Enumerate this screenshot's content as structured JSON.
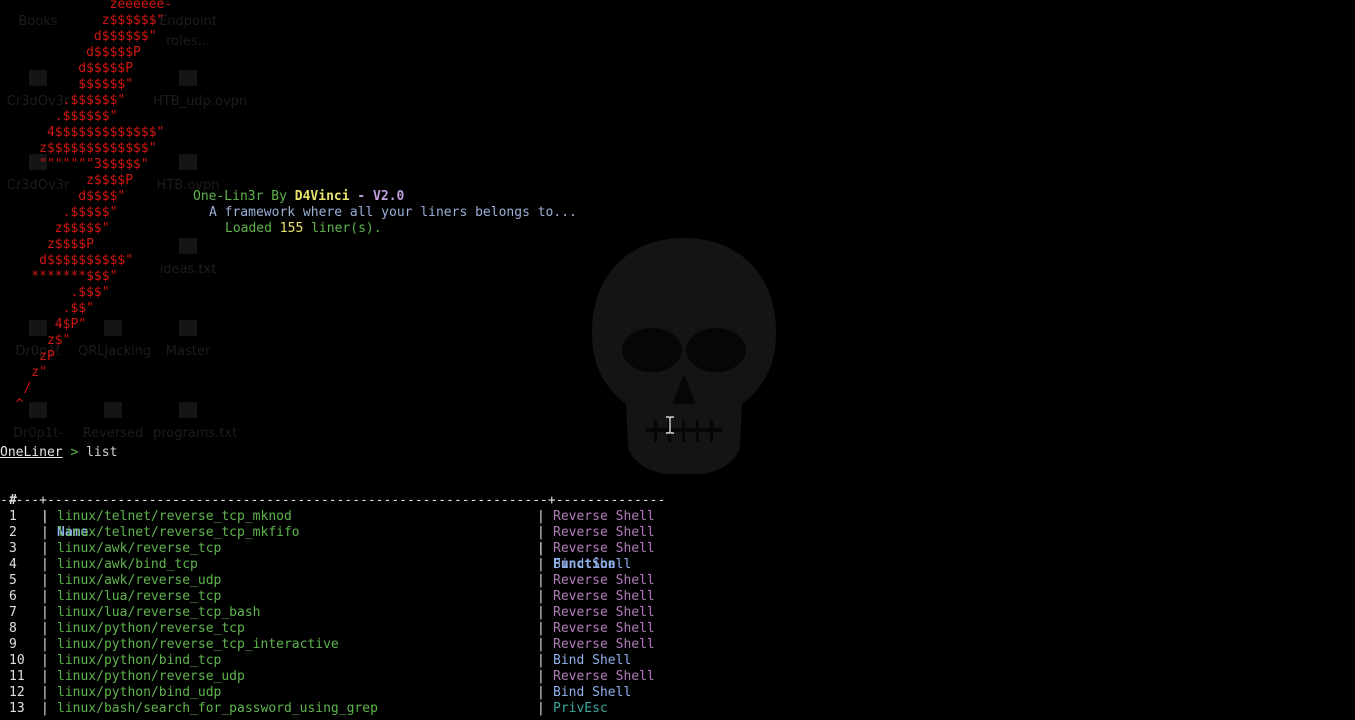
{
  "desktop": {
    "icons": [
      {
        "label": "Books"
      },
      {
        "label": "Endpoint roles..."
      },
      {
        "label": "Cr3dOv3r"
      },
      {
        "label": "HTB_udp.ovpn"
      },
      {
        "label": "Cr3dOv3r"
      },
      {
        "label": "HTB.ovpn"
      },
      {
        "label": "ideas.txt"
      },
      {
        "label": "Dr0p1t"
      },
      {
        "label": "QRLJacking"
      },
      {
        "label": "Master"
      },
      {
        "label": "Dr0p1t-"
      },
      {
        "label": "Reversed"
      },
      {
        "label": "programs.txt"
      }
    ]
  },
  "ascii_art": [
    "              zeeeeee-",
    "             z$$$$$$\"",
    "            d$$$$$$\"",
    "           d$$$$$P",
    "          d$$$$$P",
    "          $$$$$$\"",
    "        .$$$$$$\"",
    "       .$$$$$$\"",
    "      4$$$$$$$$$$$$$\"",
    "     z$$$$$$$$$$$$$\"",
    "     \"\"\"\"\"\"\"3$$$$$\"",
    "           z$$$$P",
    "          d$$$$\"",
    "        .$$$$$\"",
    "       z$$$$$\"",
    "      z$$$$P",
    "     d$$$$$$$$$$\"",
    "    *******$$$\"",
    "         .$$$\"",
    "        .$$\"",
    "       4$P\"",
    "      z$\"",
    "     zP",
    "    z\"",
    "   /",
    "  ^"
  ],
  "banner": {
    "tool": "One-Lin3r",
    "by": "By",
    "author": "D4Vinci",
    "dash": "-",
    "version": "V2.0",
    "tagline": "A framework where all your liners belongs to...",
    "loaded_prefix": "Loaded",
    "loaded_count": "155",
    "loaded_suffix": "liner(s)."
  },
  "prompt": {
    "name": "OneLiner",
    "arrow": ">",
    "command": "list"
  },
  "table": {
    "headers": {
      "num": "#",
      "name": "Name",
      "function": "Function"
    },
    "separator": "-----+----------------------------------------------------------------+--------------",
    "rows": [
      {
        "num": "1",
        "name": "linux/telnet/reverse_tcp_mknod",
        "function": "Reverse Shell"
      },
      {
        "num": "2",
        "name": "linux/telnet/reverse_tcp_mkfifo",
        "function": "Reverse Shell"
      },
      {
        "num": "3",
        "name": "linux/awk/reverse_tcp",
        "function": "Reverse Shell"
      },
      {
        "num": "4",
        "name": "linux/awk/bind_tcp",
        "function": "Bind Shell"
      },
      {
        "num": "5",
        "name": "linux/awk/reverse_udp",
        "function": "Reverse Shell"
      },
      {
        "num": "6",
        "name": "linux/lua/reverse_tcp",
        "function": "Reverse Shell"
      },
      {
        "num": "7",
        "name": "linux/lua/reverse_tcp_bash",
        "function": "Reverse Shell"
      },
      {
        "num": "8",
        "name": "linux/python/reverse_tcp",
        "function": "Reverse Shell"
      },
      {
        "num": "9",
        "name": "linux/python/reverse_tcp_interactive",
        "function": "Reverse Shell"
      },
      {
        "num": "10",
        "name": "linux/python/bind_tcp",
        "function": "Bind Shell"
      },
      {
        "num": "11",
        "name": "linux/python/reverse_udp",
        "function": "Reverse Shell"
      },
      {
        "num": "12",
        "name": "linux/python/bind_udp",
        "function": "Bind Shell"
      },
      {
        "num": "13",
        "name": "linux/bash/search_for_password_using_grep",
        "function": "PrivEsc"
      }
    ]
  },
  "colors": {
    "ascii": "#d21414",
    "green": "#5fb34d",
    "reverse_shell": "#b07ab8",
    "bind_shell": "#8fb0e8",
    "privesc": "#3fa7a0"
  }
}
